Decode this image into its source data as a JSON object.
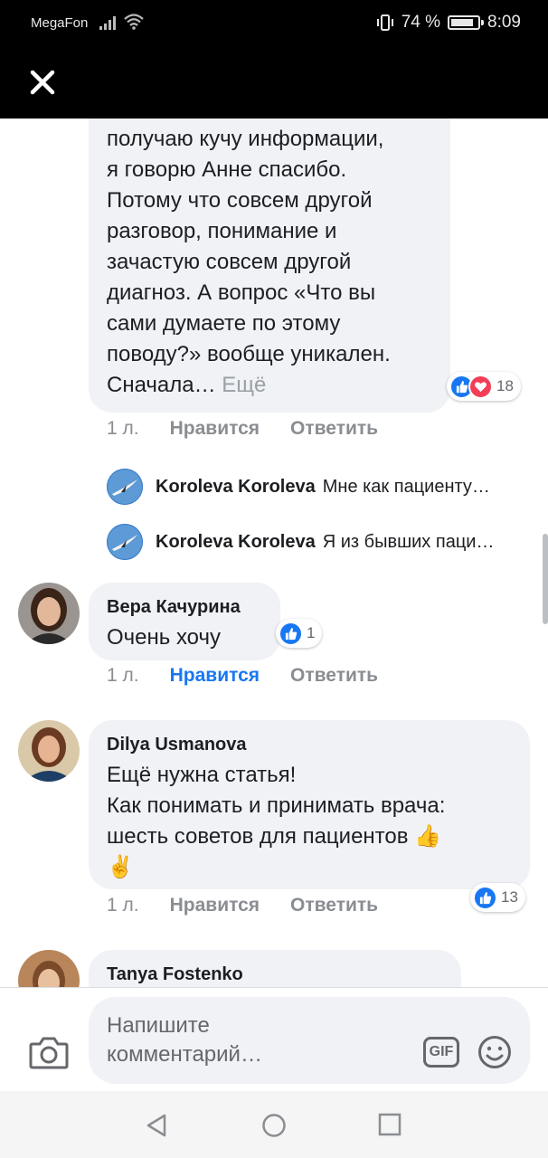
{
  "status_bar": {
    "carrier": "MegaFon",
    "battery_text": "74 %",
    "time": "8:09",
    "battery_level": 0.74
  },
  "nav": {
    "close_icon": "close-icon"
  },
  "comments": [
    {
      "text_lines": [
        "получаю кучу информации,",
        "я говорю Анне спасибо.",
        "Потому что совсем другой",
        "разговор, понимание и",
        "зачастую совсем другой",
        "диагноз. А вопрос «Что вы",
        "сами думаете по этому",
        "поводу?» вообще уникален."
      ],
      "last_line": "Сначала…",
      "more_label": "Ещё",
      "reaction_count": "18",
      "time": "1 л.",
      "like_label": "Нравится",
      "reply_label": "Ответить"
    },
    {
      "author": "Вера Качурина",
      "text": "Очень хочу",
      "reaction_count": "1",
      "time": "1 л.",
      "like_label": "Нравится",
      "reply_label": "Ответить"
    },
    {
      "author": "Dilya Usmanova",
      "text_lines": [
        "Ещё нужна статья!",
        "Как понимать и принимать врача:",
        "шесть советов для пациентов 👍",
        "✌️"
      ],
      "reaction_count": "13",
      "time": "1 л.",
      "like_label": "Нравится",
      "reply_label": "Ответить"
    },
    {
      "author": "Tanya Fostenko"
    }
  ],
  "replies": [
    {
      "author": "Koroleva Koroleva",
      "text": "Мне как пациенту…"
    },
    {
      "author": "Koroleva Koroleva",
      "text": "Я из бывших паци…"
    }
  ],
  "composer": {
    "placeholder_line1": "Напишите",
    "placeholder_line2": "комментарий…",
    "gif_label": "GIF"
  },
  "colors": {
    "accent": "#1877f2",
    "bubble": "#f0f2f5",
    "love": "#f33e58"
  }
}
